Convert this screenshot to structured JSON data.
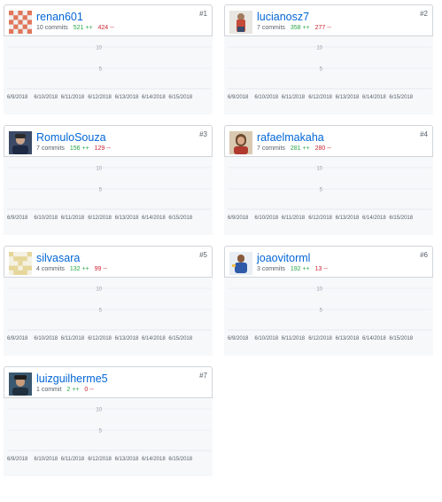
{
  "graph": {
    "y_ticks": [
      "10",
      "5"
    ],
    "x_labels": [
      "6/9/2018",
      "6/10/2018",
      "6/11/2018",
      "6/12/2018",
      "6/13/2018",
      "6/14/2018",
      "6/15/2018"
    ],
    "colors": {
      "plot_bg": "#f6f8fa",
      "grid": "#e1e4e8",
      "link": "#0366d6",
      "add": "#28a745",
      "del": "#cb2431"
    }
  },
  "contributors": [
    {
      "rank": "#1",
      "login": "renan601",
      "commits": "10 commits",
      "additions": "521 ++",
      "deletions": "424 --",
      "avatar_icon": "identicon-avatar-icon"
    },
    {
      "rank": "#2",
      "login": "lucianosz7",
      "commits": "7 commits",
      "additions": "358 ++",
      "deletions": "277 --",
      "avatar_icon": "user-photo-avatar-icon"
    },
    {
      "rank": "#3",
      "login": "RomuloSouza",
      "commits": "7 commits",
      "additions": "156 ++",
      "deletions": "129 --",
      "avatar_icon": "user-photo-avatar-icon"
    },
    {
      "rank": "#4",
      "login": "rafaelmakaha",
      "commits": "7 commits",
      "additions": "281 ++",
      "deletions": "280 --",
      "avatar_icon": "user-photo-avatar-icon"
    },
    {
      "rank": "#5",
      "login": "silvasara",
      "commits": "4 commits",
      "additions": "132 ++",
      "deletions": "99 --",
      "avatar_icon": "identicon-avatar-icon"
    },
    {
      "rank": "#6",
      "login": "joaovitorml",
      "commits": "3 commits",
      "additions": "192 ++",
      "deletions": "13 --",
      "avatar_icon": "user-photo-avatar-icon"
    },
    {
      "rank": "#7",
      "login": "luizguilherme5",
      "commits": "1 commit",
      "additions": "2 ++",
      "deletions": "0 --",
      "avatar_icon": "user-photo-avatar-icon"
    }
  ]
}
